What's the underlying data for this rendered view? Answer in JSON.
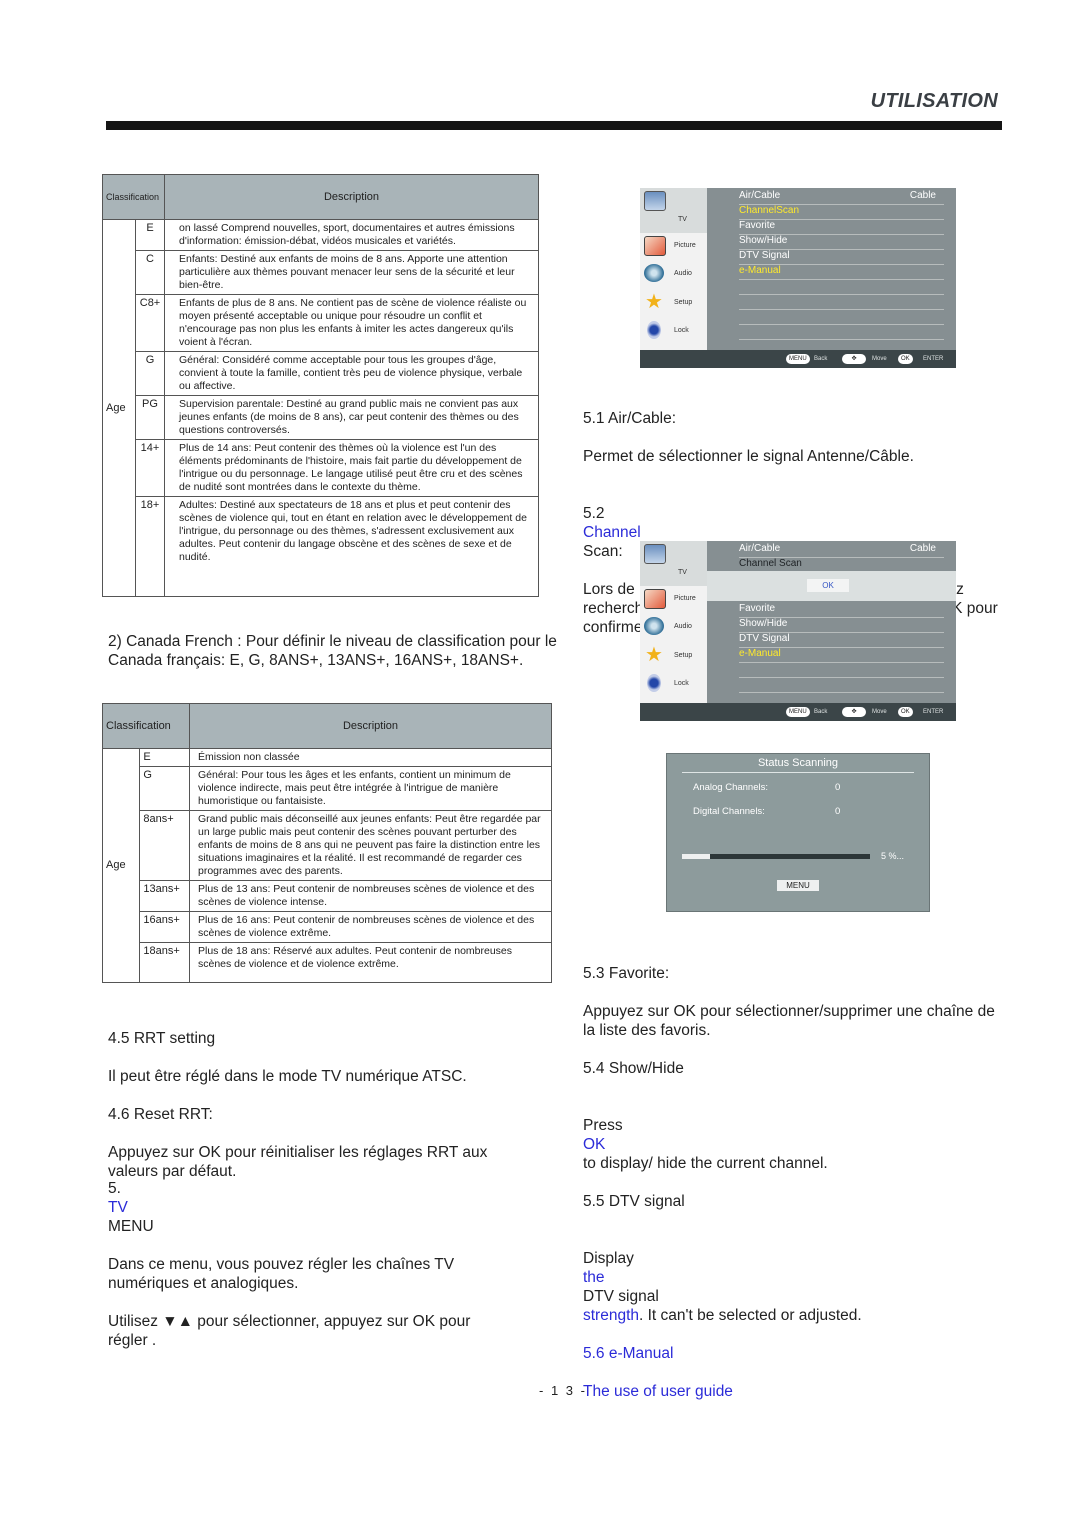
{
  "header": {
    "section_title": "UTILISATION"
  },
  "table_us": {
    "header": {
      "classification": "Classification",
      "description": "Description"
    },
    "age_label": "Age",
    "rows": [
      {
        "code": "E",
        "description": "on lassé Comprend nouvelles, sport, documentaires et autres émissions d'information: émission-débat, vidéos musicales et variétés."
      },
      {
        "code": "C",
        "description": "Enfants: Destiné aux enfants de moins de 8 ans. Apporte une attention particulière aux thèmes pouvant menacer leur sens de la sécurité et leur bien-être."
      },
      {
        "code": "C8+",
        "description": "Enfants de plus de 8 ans. Ne contient pas de scène de violence réaliste ou moyen présenté acceptable ou unique pour résoudre un conflit et n'encourage pas non plus les enfants à imiter les actes dangereux qu'ils voient à l'écran."
      },
      {
        "code": "G",
        "description": "Général: Considéré comme acceptable pour tous les groupes d'âge, convient à toute la famille, contient très peu de violence physique, verbale ou affective."
      },
      {
        "code": "PG",
        "description": "Supervision parentale: Destiné au grand public mais ne convient pas aux jeunes enfants (de moins de 8 ans), car peut contenir des thèmes ou des questions controversés."
      },
      {
        "code": "14+",
        "description": "Plus de 14 ans: Peut contenir des thèmes où la violence est l'un des éléments prédominants de l'histoire, mais fait partie du développement de l'intrigue ou du personnage. Le langage utilisé peut être cru et des scènes de nudité sont montrées dans le contexte du thème."
      },
      {
        "code": "18+",
        "description": "Adultes: Destiné aux spectateurs de 18 ans et plus et peut contenir des scènes de violence qui, tout en étant en relation avec le développement de l'intrigue, du personnage ou des thèmes, s'adressent exclusivement aux adultes. Peut contenir du langage obscène et des scènes de sexe et de nudité."
      }
    ]
  },
  "canada_french_intro": "2) Canada French : Pour définir le niveau de classification pour le Canada français: E, G, 8ANS+, 13ANS+, 16ANS+, 18ANS+.",
  "table_fr": {
    "header": {
      "classification": "Classification",
      "description": "Description"
    },
    "age_label": "Age",
    "rows": [
      {
        "code": "E",
        "description": "Émission non classée"
      },
      {
        "code": "G",
        "description": "Général: Pour tous les âges et les enfants, contient un minimum de violence indirecte, mais peut être intégrée à l'intrigue de manière humoristique ou fantaisiste."
      },
      {
        "code": "8ans+",
        "description": "Grand public mais déconseillé aux jeunes enfants: Peut être regardée par un large public mais peut contenir des scènes pouvant perturber des enfants de moins de 8 ans qui ne peuvent pas faire la distinction entre les situations imaginaires et la réalité. Il est recommandé de regarder ces programmes avec des parents."
      },
      {
        "code": "13ans+",
        "description": "Plus de 13 ans: Peut contenir de nombreuses scènes de violence et des scènes de violence intense."
      },
      {
        "code": "16ans+",
        "description": "Plus de 16 ans: Peut contenir de nombreuses scènes de violence et des scènes de violence extrême."
      },
      {
        "code": "18ans+",
        "description": "Plus de 18 ans: Réservé aux adultes. Peut contenir de nombreuses scènes de violence et de violence extrême."
      }
    ]
  },
  "left_text": {
    "s45_title": "4.5 RRT setting",
    "s45_body": "Il peut être réglé dans le mode TV numérique ATSC.",
    "s46_title": "4.6 Reset RRT:",
    "s46_body": "Appuyez sur OK pour réinitialiser les réglages RRT aux valeurs par défaut.",
    "s5_num": "5.",
    "s5_tv": "TV",
    "s5_menu": "MENU",
    "s5_body1": "Dans ce menu, vous pouvez régler les chaînes TV numériques et analogiques.",
    "s5_body2": "Utilisez ▼▲ pour sélectionner, appuyez sur OK pour régler ."
  },
  "tv_menu_1": {
    "sidebar": [
      {
        "label": "TV",
        "icon": "tv-icon"
      },
      {
        "label": "Picture",
        "icon": "picture-icon"
      },
      {
        "label": "Audio",
        "icon": "audio-icon"
      },
      {
        "label": "Setup",
        "icon": "setup-icon"
      },
      {
        "label": "Lock",
        "icon": "lock-icon"
      }
    ],
    "items": [
      {
        "label": "Air/Cable",
        "value": "Cable"
      },
      {
        "label": "ChannelScan",
        "value": ""
      },
      {
        "label": "Favorite",
        "value": ""
      },
      {
        "label": "Show/Hide",
        "value": ""
      },
      {
        "label": "DTV Signal",
        "value": ""
      },
      {
        "label": "e-Manual",
        "value": ""
      }
    ],
    "footer": {
      "menu": "MENU",
      "back": "Back",
      "move": "Move",
      "ok": "OK",
      "enter": "ENTER"
    }
  },
  "right_text_1": {
    "s51_title": "5.1 Air/Cable:",
    "s51_body": "Permet de sélectionner le signal Antenne/Câble.",
    "s52_num": "5.2",
    "s52_channel": "Channel",
    "s52_rest": "Scan:",
    "s52_body": "Lors de la première utilisation du téléviseur, vous devez rechercher toutes les chaînes d'abord. Appuyez sur OK pour confirmer et afficher l'écran suivant."
  },
  "tv_menu_2": {
    "sidebar": [
      {
        "label": "TV",
        "icon": "tv-icon"
      },
      {
        "label": "Picture",
        "icon": "picture-icon"
      },
      {
        "label": "Audio",
        "icon": "audio-icon"
      },
      {
        "label": "Setup",
        "icon": "setup-icon"
      },
      {
        "label": "Lock",
        "icon": "lock-icon"
      }
    ],
    "items": [
      {
        "label": "Air/Cable",
        "value": "Cable"
      },
      {
        "label": "Channel Scan",
        "value": ""
      },
      {
        "label": "Favorite",
        "value": ""
      },
      {
        "label": "Show/Hide",
        "value": ""
      },
      {
        "label": "DTV Signal",
        "value": ""
      },
      {
        "label": "e-Manual",
        "value": ""
      }
    ],
    "ok_button": "OK",
    "footer": {
      "menu": "MENU",
      "back": "Back",
      "move": "Move",
      "ok": "OK",
      "enter": "ENTER"
    }
  },
  "scan_status": {
    "title": "Status Scanning",
    "analog_label": "Analog Channels:",
    "analog_value": "0",
    "digital_label": "Digital Channels:",
    "digital_value": "0",
    "progress_percent": 5,
    "progress_text": "5 %...",
    "menu_button": "MENU"
  },
  "right_text_2": {
    "s53_title": "5.3 Favorite:",
    "s53_body": "Appuyez sur OK pour sélectionner/supprimer une chaîne de la liste des favoris.",
    "s54_title": "5.4 Show/Hide",
    "s54_press": "Press",
    "s54_ok": "OK",
    "s54_rest": "to display/ hide the current channel.",
    "s55_title": "5.5 DTV signal",
    "s55_display": "Display",
    "s55_the": "the",
    "s55_mid": "DTV signal",
    "s55_strength": "strength",
    "s55_rest": ". It can't be selected or adjusted.",
    "s56_title": "5.6 e-Manual",
    "s56_body": "The use of user guide"
  },
  "page_number": "- 1 3 -"
}
